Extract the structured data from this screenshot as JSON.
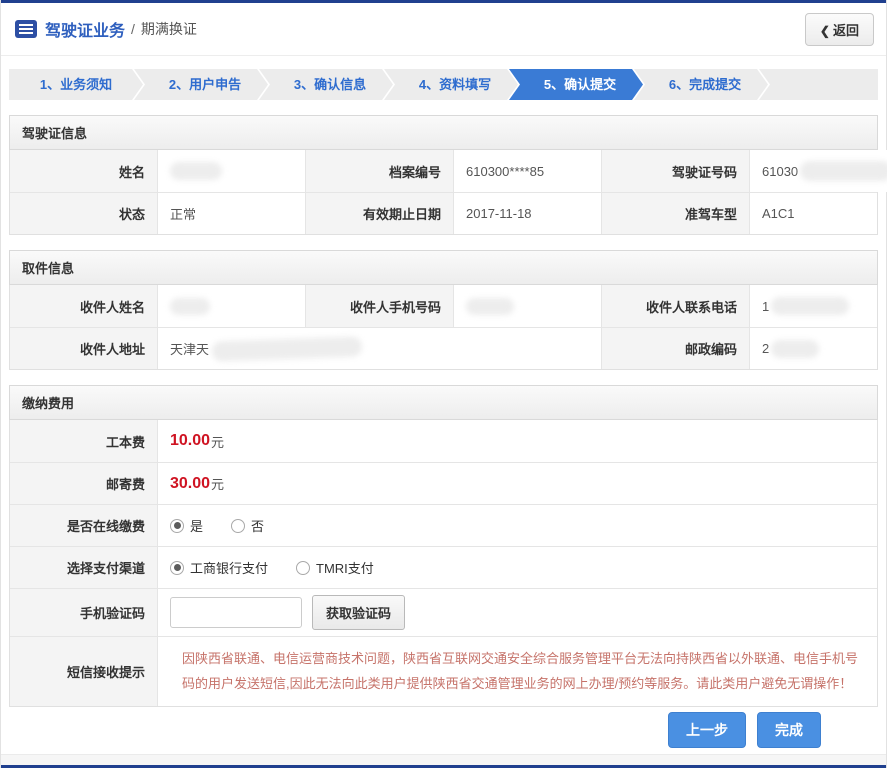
{
  "header": {
    "icon": "form-list-icon",
    "title": "驾驶证业务",
    "separator": "/",
    "subtitle": "期满换证",
    "back_arrow": "❮",
    "back_label": "返回"
  },
  "steps": {
    "items": [
      {
        "label": "1、业务须知",
        "active": false
      },
      {
        "label": "2、用户申告",
        "active": false
      },
      {
        "label": "3、确认信息",
        "active": false
      },
      {
        "label": "4、资料填写",
        "active": false
      },
      {
        "label": "5、确认提交",
        "active": true
      },
      {
        "label": "6、完成提交",
        "active": false
      }
    ]
  },
  "license": {
    "title": "驾驶证信息",
    "row1": {
      "c1_label": "姓名",
      "c1_value": "",
      "c2_label": "档案编号",
      "c2_value": "610300****85",
      "c3_label": "驾驶证号码",
      "c3_value": "61030"
    },
    "row2": {
      "c1_label": "状态",
      "c1_value": "正常",
      "c2_label": "有效期止日期",
      "c2_value": "2017-11-18",
      "c3_label": "准驾车型",
      "c3_value": "A1C1"
    }
  },
  "pickup": {
    "title": "取件信息",
    "row1": {
      "c1_label": "收件人姓名",
      "c1_value": "",
      "c2_label": "收件人手机号码",
      "c2_value": "",
      "c3_label": "收件人联系电话",
      "c3_value": "1"
    },
    "row2": {
      "c1_label": "收件人地址",
      "c1_value": "天津天",
      "c2_label": "邮政编码",
      "c2_value": "2"
    }
  },
  "fees": {
    "title": "缴纳费用",
    "production_fee_label": "工本费",
    "production_fee_amount": "10.00",
    "production_fee_unit": "元",
    "mail_fee_label": "邮寄费",
    "mail_fee_amount": "30.00",
    "mail_fee_unit": "元",
    "online_pay_label": "是否在线缴费",
    "online_yes": "是",
    "online_no": "否",
    "channel_label": "选择支付渠道",
    "channel_icbc": "工商银行支付",
    "channel_tmri": "TMRI支付",
    "sms_code_label": "手机验证码",
    "sms_code_button": "获取验证码",
    "notice_label": "短信接收提示",
    "notice_text": "因陕西省联通、电信运营商技术问题，陕西省互联网交通安全综合服务管理平台无法向持陕西省以外联通、电信手机号码的用户发送短信,因此无法向此类用户提供陕西省交通管理业务的网上办理/预约等服务。请此类用户避免无谓操作！"
  },
  "footer": {
    "prev_label": "上一步",
    "done_label": "完成"
  },
  "colors": {
    "top_bottom_line": "#20408f",
    "title_blue": "#2e5fbe",
    "step_text_blue": "#2e6ccf",
    "active_step_bg": "#3a7bd5",
    "fee_red": "#cf1322",
    "notice_red": "#c6736a",
    "button_blue": "#4a90e2"
  }
}
